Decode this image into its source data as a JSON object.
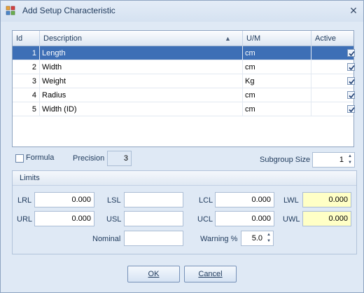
{
  "window": {
    "title": "Add Setup Characteristic",
    "close_glyph": "✕",
    "icon": "app-grid-icon"
  },
  "grid": {
    "columns": [
      "Id",
      "Description",
      "U/M",
      "Active"
    ],
    "sort_indicator": "▲",
    "rows": [
      {
        "id": "1",
        "description": "Length",
        "um": "cm",
        "active": true,
        "selected": true
      },
      {
        "id": "2",
        "description": "Width",
        "um": "cm",
        "active": true,
        "selected": false
      },
      {
        "id": "3",
        "description": "Weight",
        "um": "Kg",
        "active": true,
        "selected": false
      },
      {
        "id": "4",
        "description": "Radius",
        "um": "cm",
        "active": true,
        "selected": false
      },
      {
        "id": "5",
        "description": "Width (ID)",
        "um": "cm",
        "active": true,
        "selected": false
      }
    ]
  },
  "options": {
    "formula_label": "Formula",
    "formula_checked": false,
    "precision_label": "Precision",
    "precision_value": "3",
    "subgroup_label": "Subgroup Size",
    "subgroup_value": "1"
  },
  "limits": {
    "title": "Limits",
    "lrl_label": "LRL",
    "lrl_value": "0.000",
    "lsl_label": "LSL",
    "lsl_value": "",
    "lcl_label": "LCL",
    "lcl_value": "0.000",
    "lwl_label": "LWL",
    "lwl_value": "0.000",
    "url_label": "URL",
    "url_value": "0.000",
    "usl_label": "USL",
    "usl_value": "",
    "ucl_label": "UCL",
    "ucl_value": "0.000",
    "uwl_label": "UWL",
    "uwl_value": "0.000",
    "nominal_label": "Nominal",
    "nominal_value": "",
    "warning_label": "Warning %",
    "warning_value": "5.0"
  },
  "buttons": {
    "ok": "OK",
    "cancel": "Cancel"
  },
  "colors": {
    "selection": "#3d6fb6",
    "warning_fill": "#ffffc6",
    "window_bg": "#dfe9f5"
  }
}
